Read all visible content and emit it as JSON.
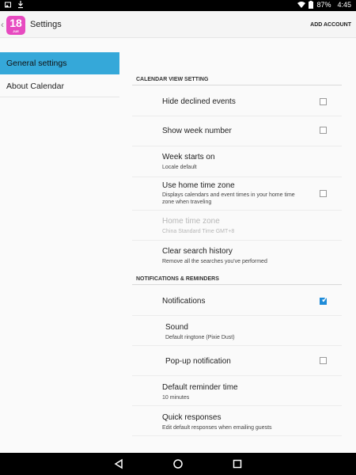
{
  "status_bar": {
    "battery": "87%",
    "time": "4:45"
  },
  "app_bar": {
    "icon_number": "18",
    "icon_sub": "JUE",
    "title": "Settings",
    "add_account": "ADD ACCOUNT"
  },
  "sidebar": {
    "items": [
      {
        "label": "General settings"
      },
      {
        "label": "About Calendar"
      }
    ]
  },
  "sections": {
    "calendar_view": {
      "header": "CALENDAR VIEW SETTING",
      "hide_declined": {
        "title": "Hide declined events",
        "checked": false
      },
      "show_week_number": {
        "title": "Show week number",
        "checked": false
      },
      "week_starts_on": {
        "title": "Week starts on",
        "summary": "Locale default"
      },
      "home_time_zone": {
        "title": "Use home time zone",
        "summary": "Displays calendars and event times in your home time zone when traveling",
        "checked": false
      },
      "home_tz_value": {
        "title": "Home time zone",
        "summary": "China Standard Time  GMT+8"
      },
      "clear_search": {
        "title": "Clear search history",
        "summary": "Remove all the searches you've performed"
      }
    },
    "notifications": {
      "header": "NOTIFICATIONS & REMINDERS",
      "notifications": {
        "title": "Notifications",
        "checked": true
      },
      "sound": {
        "title": "Sound",
        "summary": "Default ringtone (Pixie Dust)"
      },
      "popup": {
        "title": "Pop-up notification",
        "checked": false
      },
      "default_reminder": {
        "title": "Default reminder time",
        "summary": "10 minutes"
      },
      "quick_responses": {
        "title": "Quick responses",
        "summary": "Edit default responses when emailing guests"
      }
    }
  },
  "colors": {
    "accent": "#35a8d9",
    "app_icon": "#e74ac0",
    "checkbox_checked": "#1e8bd8"
  }
}
